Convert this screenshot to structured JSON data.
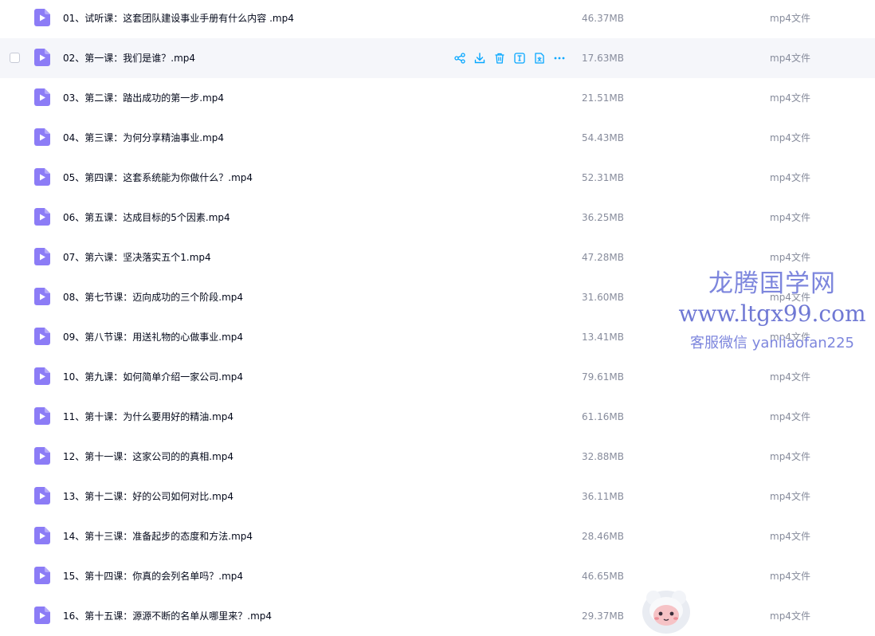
{
  "files": [
    {
      "name": "01、试听课：这套团队建设事业手册有什么内容 .mp4",
      "size": "46.37MB",
      "type": "mp4文件"
    },
    {
      "name": "02、第一课：我们是谁？.mp4",
      "size": "17.63MB",
      "type": "mp4文件",
      "hovered": true
    },
    {
      "name": "03、第二课：踏出成功的第一步.mp4",
      "size": "21.51MB",
      "type": "mp4文件"
    },
    {
      "name": "04、第三课：为何分享精油事业.mp4",
      "size": "54.43MB",
      "type": "mp4文件"
    },
    {
      "name": "05、第四课：这套系统能为你做什么？.mp4",
      "size": "52.31MB",
      "type": "mp4文件"
    },
    {
      "name": "06、第五课：达成目标的5个因素.mp4",
      "size": "36.25MB",
      "type": "mp4文件"
    },
    {
      "name": "07、第六课：坚决落实五个1.mp4",
      "size": "47.28MB",
      "type": "mp4文件"
    },
    {
      "name": "08、第七节课：迈向成功的三个阶段.mp4",
      "size": "31.60MB",
      "type": "mp4文件"
    },
    {
      "name": "09、第八节课：用送礼物的心做事业.mp4",
      "size": "13.41MB",
      "type": "mp4文件"
    },
    {
      "name": "10、第九课：如何简单介绍一家公司.mp4",
      "size": "79.61MB",
      "type": "mp4文件"
    },
    {
      "name": "11、第十课：为什么要用好的精油.mp4",
      "size": "61.16MB",
      "type": "mp4文件"
    },
    {
      "name": "12、第十一课：这家公司的的真相.mp4",
      "size": "32.88MB",
      "type": "mp4文件"
    },
    {
      "name": "13、第十二课：好的公司如何对比.mp4",
      "size": "36.11MB",
      "type": "mp4文件"
    },
    {
      "name": "14、第十三课：准备起步的态度和方法.mp4",
      "size": "28.46MB",
      "type": "mp4文件"
    },
    {
      "name": "15、第十四课：你真的会列名单吗？.mp4",
      "size": "46.65MB",
      "type": "mp4文件"
    },
    {
      "name": "16、第十五课：源源不断的名单从哪里来？.mp4",
      "size": "29.37MB",
      "type": "mp4文件"
    }
  ],
  "row_actions": [
    {
      "name": "share-icon"
    },
    {
      "name": "download-icon"
    },
    {
      "name": "delete-icon"
    },
    {
      "name": "rename-icon"
    },
    {
      "name": "translate-icon"
    },
    {
      "name": "more-icon"
    }
  ],
  "watermark": {
    "brand": "龙腾国学网",
    "url": "www.ltgx99.com",
    "contact": "客服微信 yanliaofan225"
  },
  "colors": {
    "accent": "#06a7ff",
    "file_icon": "#8c7cf6",
    "hover_row": "#f5f6fa",
    "muted_text": "#878c9c",
    "watermark": "#7d86dd"
  }
}
